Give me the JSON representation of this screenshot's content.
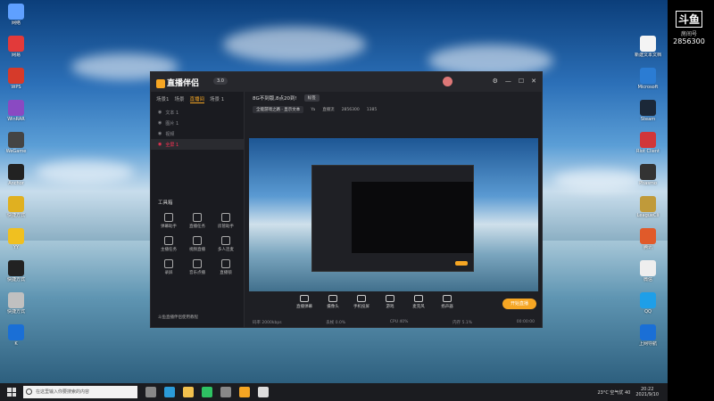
{
  "watermark": {
    "logo": "斗鱼",
    "line": "房间号",
    "room_id": "2856300"
  },
  "desktop_left": [
    {
      "label": "网络",
      "color": "#5fa0ff"
    },
    {
      "label": "网易",
      "color": "#e23a3a"
    },
    {
      "label": "WPS",
      "color": "#d63a2a"
    },
    {
      "label": "WinRAR",
      "color": "#8a4ac2"
    },
    {
      "label": "WeGame",
      "color": "#444"
    },
    {
      "label": "Anchor",
      "color": "#222"
    },
    {
      "label": "快捷方式",
      "color": "#e0b020"
    },
    {
      "label": "YY",
      "color": "#f0c020"
    },
    {
      "label": "快捷方式",
      "color": "#222"
    },
    {
      "label": "快捷方式",
      "color": "#c0c0c0"
    },
    {
      "label": "K",
      "color": "#1a6fd6"
    }
  ],
  "desktop_right": [
    {
      "label": "新建文本文档",
      "color": "#f4f4f4"
    },
    {
      "label": "Microsoft",
      "color": "#2b7cd3"
    },
    {
      "label": "Steam",
      "color": "#1b2838"
    },
    {
      "label": "Riot Client",
      "color": "#d13639"
    },
    {
      "label": "Phasmo",
      "color": "#333"
    },
    {
      "label": "LeagueCli",
      "color": "#c09a3a"
    },
    {
      "label": "腾讯",
      "color": "#e05a2a"
    },
    {
      "label": "微信",
      "color": "#eee"
    },
    {
      "label": "QQ",
      "color": "#1e9fe8"
    },
    {
      "label": "上网导航",
      "color": "#1a6fd6"
    }
  ],
  "app": {
    "logo": "直播伴侣",
    "version": "3.0",
    "controls": [
      "⚙",
      "—",
      "☐",
      "✕"
    ],
    "tabs": [
      {
        "label": "场景1",
        "on": false
      },
      {
        "label": "场景",
        "on": false
      },
      {
        "label": "直播间",
        "on": true
      },
      {
        "label": "场景 1",
        "on": false
      }
    ],
    "scenes": [
      {
        "label": "文本 1",
        "sel": false
      },
      {
        "label": "图片 1",
        "sel": false
      },
      {
        "label": "视频",
        "sel": false
      },
      {
        "label": "全屏 1",
        "sel": true
      }
    ],
    "toolbox_title": "工具箱",
    "tools": [
      {
        "label": "弹幕助手"
      },
      {
        "label": "直播任务"
      },
      {
        "label": "房管助手"
      },
      {
        "label": "主播任务"
      },
      {
        "label": "视频直播"
      },
      {
        "label": "多人连麦"
      },
      {
        "label": "录屏"
      },
      {
        "label": "音乐点播"
      },
      {
        "label": "直播锁"
      }
    ],
    "left_footer": "斗鱼直播伴侣使用教程",
    "room_title": "8G不到版,8点20到!",
    "room_chip": "标签",
    "category": "全能游戏之路 · 显示文本",
    "info": [
      "Ya",
      "直播流",
      "2856300",
      "1385"
    ],
    "bottom_items": [
      {
        "label": "直播弹幕"
      },
      {
        "label": "摄像头"
      },
      {
        "label": "手机投屏"
      },
      {
        "label": "游戏"
      },
      {
        "label": "麦克风"
      },
      {
        "label": "扬声器"
      }
    ],
    "start_button": "开始直播",
    "stats": [
      "码率 2000kbps",
      "丢帧 0.0%",
      "CPU 40%",
      "内存 5.1%",
      "00:00:00"
    ]
  },
  "taskbar": {
    "search_placeholder": "在这里输入你要搜索的内容",
    "icons": [
      {
        "name": "task-view-icon",
        "color": "#888"
      },
      {
        "name": "edge-icon",
        "color": "#2b9bd8"
      },
      {
        "name": "explorer-icon",
        "color": "#f2c14e"
      },
      {
        "name": "wechat-icon",
        "color": "#2ec263"
      },
      {
        "name": "app-icon",
        "color": "#888"
      },
      {
        "name": "huya-icon",
        "color": "#f6a623"
      },
      {
        "name": "app2-icon",
        "color": "#ddd"
      }
    ],
    "weather": "23°C 空气优 40",
    "time": "20:22",
    "date": "2021/9/10"
  }
}
